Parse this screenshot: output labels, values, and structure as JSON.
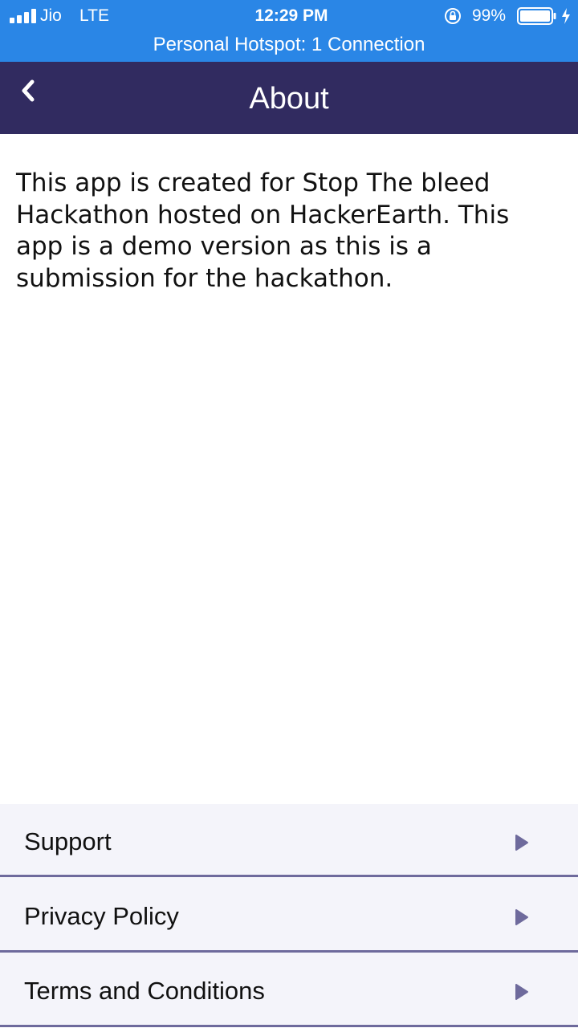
{
  "status_bar": {
    "carrier": "Jio",
    "network": "LTE",
    "time": "12:29 PM",
    "battery": "99%",
    "hotspot": "Personal Hotspot: 1 Connection",
    "icons": [
      "signal-icon",
      "rotation-lock-icon",
      "battery-icon",
      "charging-bolt-icon"
    ]
  },
  "nav": {
    "title": "About",
    "back_icon": "chevron-left-icon"
  },
  "about": {
    "body": "This app is created for Stop The bleed Hackathon hosted on HackerEarth. This app is a demo version as this is a submission for the hackathon."
  },
  "menu": {
    "items": [
      {
        "label": "Support",
        "icon": "arrow-right-icon"
      },
      {
        "label": "Privacy Policy",
        "icon": "arrow-right-icon"
      },
      {
        "label": "Terms and Conditions",
        "icon": "arrow-right-icon"
      }
    ]
  },
  "colors": {
    "status_bar": "#2a86e6",
    "nav_bar": "#312b60",
    "menu_background": "#f4f4fa",
    "accent": "#6e6a9c"
  }
}
